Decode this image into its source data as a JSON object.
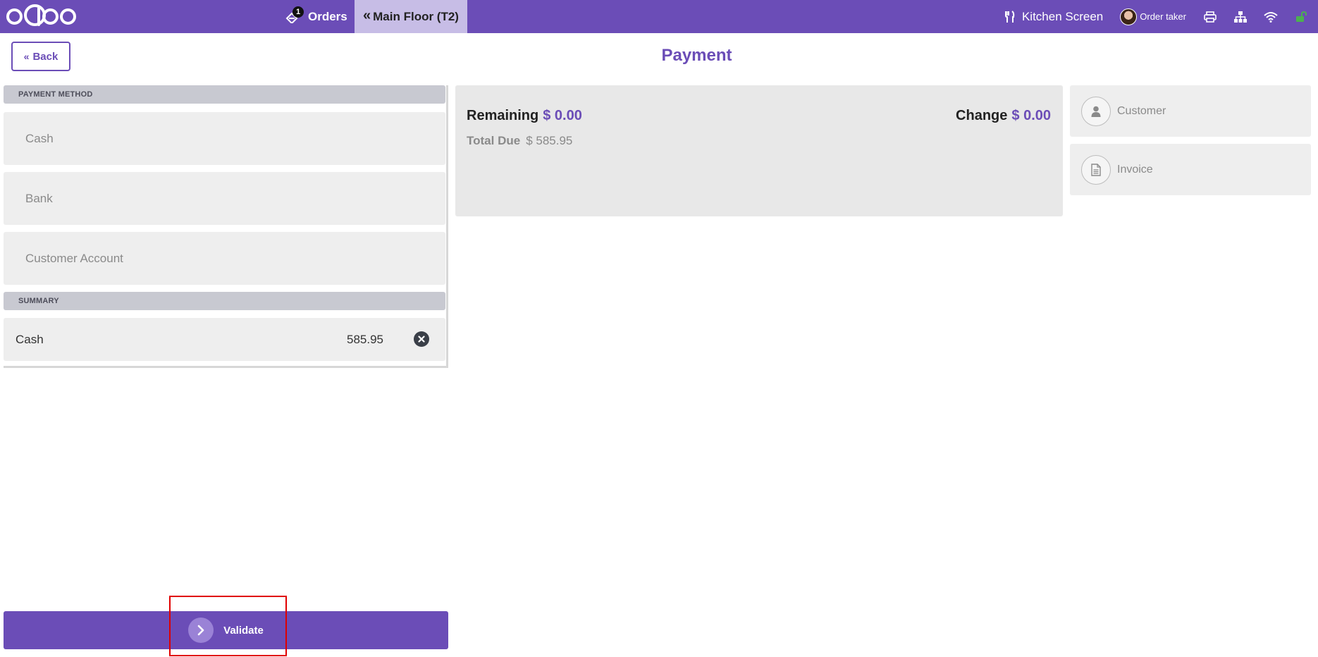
{
  "navbar": {
    "logo_text": "odoo",
    "orders_label": "Orders",
    "orders_badge": "1",
    "floor_label": "Main Floor (T2)",
    "kitchen_label": "Kitchen Screen",
    "user_label": "Order taker",
    "icons": [
      "orders-icon",
      "chevrons-left-icon",
      "utensils-icon",
      "printer-icon",
      "sitemap-icon",
      "wifi-icon",
      "unlock-icon"
    ],
    "bg_color": "#6b4db7"
  },
  "header": {
    "back_label": "Back",
    "title": "Payment"
  },
  "payment_methods": {
    "section_title": "PAYMENT METHOD",
    "items": [
      {
        "label": "Cash"
      },
      {
        "label": "Bank"
      },
      {
        "label": "Customer Account"
      }
    ]
  },
  "summary": {
    "section_title": "SUMMARY",
    "lines": [
      {
        "method": "Cash",
        "amount": "585.95"
      }
    ]
  },
  "status": {
    "remaining_label": "Remaining",
    "remaining_value": "$ 0.00",
    "change_label": "Change",
    "change_value": "$ 0.00",
    "total_due_label": "Total Due",
    "total_due_value": "$ 585.95"
  },
  "side_actions": {
    "customer_label": "Customer",
    "invoice_label": "Invoice"
  },
  "footer": {
    "validate_label": "Validate"
  },
  "colors": {
    "accent": "#6b4db7",
    "highlight": "#e00000"
  }
}
